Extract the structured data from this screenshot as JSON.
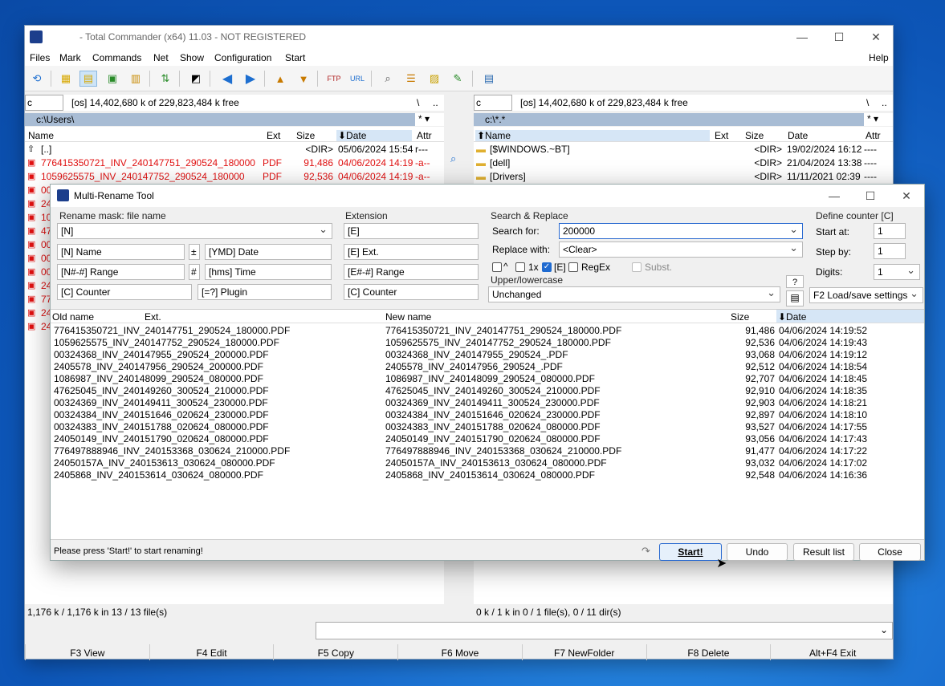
{
  "main": {
    "title": "- Total Commander (x64) 11.03 - NOT REGISTERED",
    "menu": [
      "Files",
      "Mark",
      "Commands",
      "Net",
      "Show",
      "Configuration",
      "Start"
    ],
    "help": "Help",
    "left": {
      "drive": "c",
      "free": "[os]  14,402,680 k of 229,823,484 k free",
      "path": "c:\\Users\\",
      "root": "\\",
      "up": "..",
      "star": "*",
      "cols": {
        "name": "Name",
        "ext": "Ext",
        "size": "Size",
        "date": "⬇Date",
        "attr": "Attr"
      },
      "rows": [
        {
          "name": "[..]",
          "ext": "",
          "size": "<DIR>",
          "date": "05/06/2024 15:54",
          "attr": "r---",
          "red": false
        },
        {
          "name": "776415350721_INV_240147751_290524_180000",
          "ext": "PDF",
          "size": "91,486",
          "date": "04/06/2024 14:19",
          "attr": "-a--",
          "red": true
        },
        {
          "name": "1059625575_INV_240147752_290524_180000",
          "ext": "PDF",
          "size": "92,536",
          "date": "04/06/2024 14:19",
          "attr": "-a--",
          "red": true
        },
        {
          "name": "00",
          "red": true
        },
        {
          "name": "24",
          "red": true
        },
        {
          "name": "10",
          "red": true
        },
        {
          "name": "47",
          "red": true
        },
        {
          "name": "00",
          "red": true
        },
        {
          "name": "00",
          "red": true
        },
        {
          "name": "00",
          "red": true
        },
        {
          "name": "24",
          "red": true
        },
        {
          "name": "77",
          "red": true
        },
        {
          "name": "24",
          "red": true
        },
        {
          "name": "24",
          "red": true
        }
      ],
      "status": "1,176 k / 1,176 k in 13 / 13 file(s)"
    },
    "right": {
      "drive": "c",
      "free": "[os]  14,402,680 k of 229,823,484 k free",
      "path": "c:\\*.*",
      "root": "\\",
      "up": "..",
      "star": "*",
      "cols": {
        "name": "⬆Name",
        "ext": "Ext",
        "size": "Size",
        "date": "Date",
        "attr": "Attr"
      },
      "rows": [
        {
          "name": "[$WINDOWS.~BT]",
          "size": "<DIR>",
          "date": "19/02/2024 16:12",
          "attr": "----"
        },
        {
          "name": "[dell]",
          "size": "<DIR>",
          "date": "21/04/2024 13:38",
          "attr": "----"
        },
        {
          "name": "[Drivers]",
          "size": "<DIR>",
          "date": "11/11/2021 02:39",
          "attr": "----"
        }
      ],
      "status": "0 k / 1 k in 0 / 1 file(s), 0 / 11 dir(s)"
    },
    "fkeys": [
      "F3 View",
      "F4 Edit",
      "F5 Copy",
      "F6 Move",
      "F7 NewFolder",
      "F8 Delete",
      "Alt+F4 Exit"
    ]
  },
  "dialog": {
    "title": "Multi-Rename Tool",
    "mask_label": "Rename mask: file name",
    "mask_value": "[N]",
    "mask_buttons": {
      "name": "[N]  Name",
      "range": "[N#-#]  Range",
      "counter": "[C]  Counter",
      "plus": "±",
      "hash": "#",
      "date": "[YMD]  Date",
      "time": "[hms]  Time",
      "plugin": "[=?]  Plugin"
    },
    "ext_label": "Extension",
    "ext_value": "[E]",
    "ext_buttons": {
      "ext": "[E]  Ext.",
      "range": "[E#-#]  Range",
      "counter": "[C]  Counter"
    },
    "sr_label": "Search & Replace",
    "search_label": "Search for:",
    "search_value": "200000",
    "replace_label": "Replace with:",
    "replace_value": "<Clear>",
    "opts": {
      "caret": "^",
      "once": "1x",
      "e": "[E]",
      "regex": "RegEx",
      "subst": "Subst."
    },
    "case_label": "Upper/lowercase",
    "case_value": "Unchanged",
    "counter_label": "Define counter [C]",
    "start_at_label": "Start at:",
    "start_at": "1",
    "step_label": "Step by:",
    "step": "1",
    "digits_label": "Digits:",
    "digits": "1",
    "help_q": "?",
    "load_save": "F2 Load/save settings",
    "cols": {
      "old": "Old name",
      "ext": "Ext.",
      "new": "New name",
      "size": "Size",
      "date": "⬇Date"
    },
    "rows": [
      {
        "old": "776415350721_INV_240147751_290524_180000.PDF",
        "new": "776415350721_INV_240147751_290524_180000.PDF",
        "size": "91,486",
        "date": "04/06/2024 14:19:52"
      },
      {
        "old": "1059625575_INV_240147752_290524_180000.PDF",
        "new": "1059625575_INV_240147752_290524_180000.PDF",
        "size": "92,536",
        "date": "04/06/2024 14:19:43"
      },
      {
        "old": "00324368_INV_240147955_290524_200000.PDF",
        "new": "00324368_INV_240147955_290524_.PDF",
        "size": "93,068",
        "date": "04/06/2024 14:19:12"
      },
      {
        "old": "2405578_INV_240147956_290524_200000.PDF",
        "new": "2405578_INV_240147956_290524_.PDF",
        "size": "92,512",
        "date": "04/06/2024 14:18:54"
      },
      {
        "old": "1086987_INV_240148099_290524_080000.PDF",
        "new": "1086987_INV_240148099_290524_080000.PDF",
        "size": "92,707",
        "date": "04/06/2024 14:18:45"
      },
      {
        "old": "47625045_INV_240149260_300524_210000.PDF",
        "new": "47625045_INV_240149260_300524_210000.PDF",
        "size": "92,910",
        "date": "04/06/2024 14:18:35"
      },
      {
        "old": "00324369_INV_240149411_300524_230000.PDF",
        "new": "00324369_INV_240149411_300524_230000.PDF",
        "size": "92,903",
        "date": "04/06/2024 14:18:21"
      },
      {
        "old": "00324384_INV_240151646_020624_230000.PDF",
        "new": "00324384_INV_240151646_020624_230000.PDF",
        "size": "92,897",
        "date": "04/06/2024 14:18:10"
      },
      {
        "old": "00324383_INV_240151788_020624_080000.PDF",
        "new": "00324383_INV_240151788_020624_080000.PDF",
        "size": "93,527",
        "date": "04/06/2024 14:17:55"
      },
      {
        "old": "24050149_INV_240151790_020624_080000.PDF",
        "new": "24050149_INV_240151790_020624_080000.PDF",
        "size": "93,056",
        "date": "04/06/2024 14:17:43"
      },
      {
        "old": "776497888946_INV_240153368_030624_210000.PDF",
        "new": "776497888946_INV_240153368_030624_210000.PDF",
        "size": "91,477",
        "date": "04/06/2024 14:17:22"
      },
      {
        "old": "24050157A_INV_240153613_030624_080000.PDF",
        "new": "24050157A_INV_240153613_030624_080000.PDF",
        "size": "93,032",
        "date": "04/06/2024 14:17:02"
      },
      {
        "old": "2405868_INV_240153614_030624_080000.PDF",
        "new": "2405868_INV_240153614_030624_080000.PDF",
        "size": "92,548",
        "date": "04/06/2024 14:16:36"
      }
    ],
    "status": "Please press 'Start!' to start renaming!",
    "buttons": {
      "start": "Start!",
      "undo": "Undo",
      "result": "Result list",
      "close": "Close"
    }
  }
}
